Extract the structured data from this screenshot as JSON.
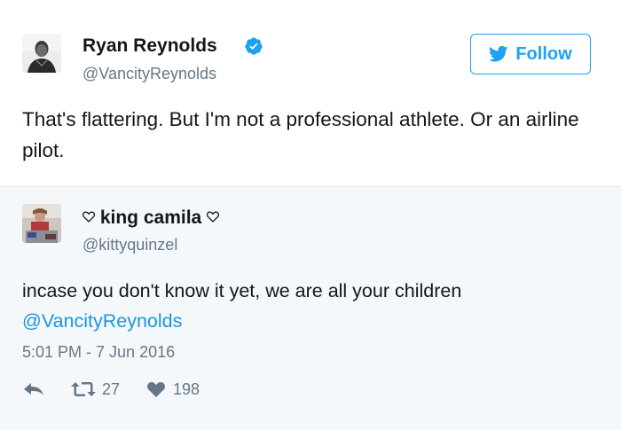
{
  "tweet": {
    "author_name": "Ryan Reynolds",
    "author_handle": "@VancityReynolds",
    "follow_label": "Follow",
    "text": "That's flattering. But I'm not a professional athlete. Or an airline pilot."
  },
  "reply": {
    "author_name": "king camila",
    "author_handle": "@kittyquinzel",
    "text": "incase you don't know it yet, we are all your children",
    "mention": "@VancityReynolds",
    "timestamp": "5:01 PM - 7 Jun 2016",
    "retweet_count": "27",
    "like_count": "198"
  },
  "colors": {
    "accent": "#1da1f2",
    "mention": "#1b95e0",
    "muted": "#657786",
    "quote_bg": "#f5f8fa"
  },
  "icons": [
    "verified-badge-icon",
    "twitter-bird-icon",
    "heart-outline-icon",
    "reply-icon",
    "retweet-icon",
    "like-icon"
  ]
}
